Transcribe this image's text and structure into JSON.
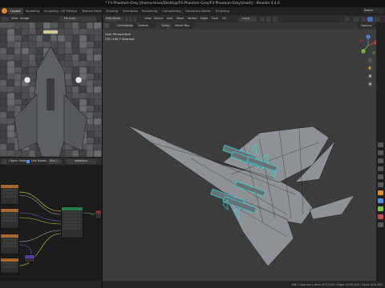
{
  "window": {
    "title": "* F4-Phantom-Grey [/home/shiva/Desktop/F4-Phantom-Grey/F4-Phantom-Grey(Used)] - Blender 4.4.0"
  },
  "workspaces": [
    "Layout",
    "Modeling",
    "Sculpting",
    "UV Editing",
    "Texture Paint",
    "Shading",
    "Animation",
    "Rendering",
    "Compositing",
    "Geometry Nodes",
    "Scripting"
  ],
  "scene": {
    "label": "Scene"
  },
  "image_editor": {
    "menus": [
      "View",
      "Image"
    ],
    "image_name": "F4-Gray"
  },
  "node_editor": {
    "menus": [
      "Object",
      "Node",
      "Use Nodes"
    ],
    "slot": "Slot 1",
    "material": "weapons"
  },
  "viewport": {
    "mode": "Edit Mode",
    "menus": [
      "View",
      "Select",
      "Add",
      "Mesh",
      "Vertex",
      "Edge",
      "Face",
      "UV"
    ],
    "transform_space": "Local",
    "orientation_label": "Orientation:",
    "orientation_value": "Default",
    "drag_label": "Drag:",
    "drag_value": "Select Box",
    "view_name": "User Perspective",
    "object_name": "(50) AIM-7 Sparrow",
    "options_label": "Options",
    "axes": [
      "X",
      "Y",
      "Z"
    ]
  },
  "status_bar": {
    "text": "AIM-7 Sparrow | Verts 0/73,916 | Edges 0/159,403 | Faces 0/55,497"
  },
  "colors": {
    "accent": "#e8862a",
    "selection": "#2fd6d6",
    "axis_x": "#e0464b",
    "axis_y": "#7ec341",
    "axis_z": "#4a8ee8"
  }
}
